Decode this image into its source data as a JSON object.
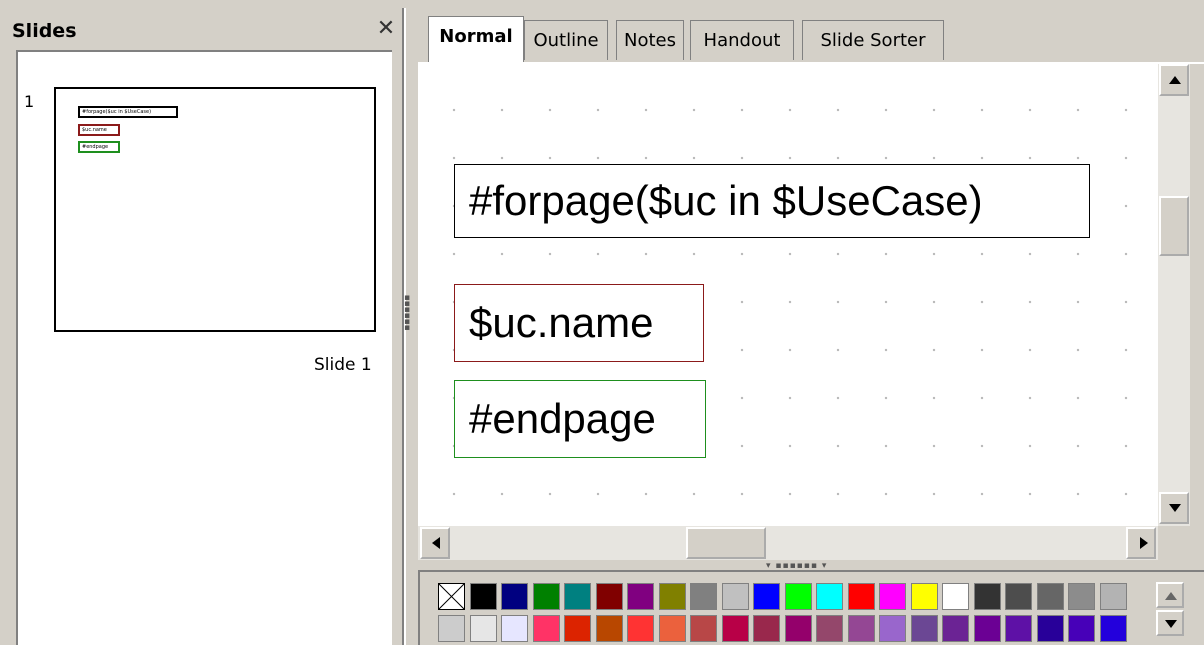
{
  "slides_pane": {
    "title": "Slides",
    "close_glyph": "✕",
    "slides": [
      {
        "number": "1",
        "caption": "Slide 1",
        "mini_texts": [
          "#forpage($uc in $UseCase)",
          "$uc.name",
          "#endpage"
        ]
      }
    ]
  },
  "tabs": [
    "Normal",
    "Outline",
    "Notes",
    "Handout",
    "Slide Sorter"
  ],
  "active_tab": "Normal",
  "slide": {
    "boxes": [
      {
        "text": "#forpage($uc in $UseCase)",
        "border_color": "#000000"
      },
      {
        "text": "$uc.name",
        "border_color": "#8b1a1a"
      },
      {
        "text": "#endpage",
        "border_color": "#1e8f1e"
      }
    ]
  },
  "icons": {
    "close": "close-icon",
    "scroll_up": "arrow-up-icon",
    "scroll_down": "arrow-down-icon",
    "scroll_left": "arrow-left-icon",
    "scroll_right": "arrow-right-icon",
    "no_fill": "no-fill-icon"
  },
  "palette": {
    "row1": [
      "none",
      "#000000",
      "#000080",
      "#008000",
      "#008080",
      "#800000",
      "#800080",
      "#808000",
      "#808080",
      "#c0c0c0",
      "#0000ff",
      "#00ff00",
      "#00ffff",
      "#ff0000",
      "#ff00ff",
      "#ffff00",
      "#ffffff",
      "#333333",
      "#4d4d4d",
      "#666666",
      "#8c8c8c",
      "#b3b3b3"
    ],
    "row2": [
      "#cccccc",
      "#e6e6e6",
      "#e6e6ff",
      "#ff3366",
      "#dc2300",
      "#b84700",
      "#ff3333",
      "#eb613d",
      "#b84747",
      "#b80047",
      "#99284c",
      "#94006b",
      "#94476b",
      "#944794",
      "#9966cc",
      "#6b4794",
      "#6b2394",
      "#6b0094",
      "#5e11a6",
      "#280099",
      "#4700b8",
      "#2300dc"
    ]
  }
}
